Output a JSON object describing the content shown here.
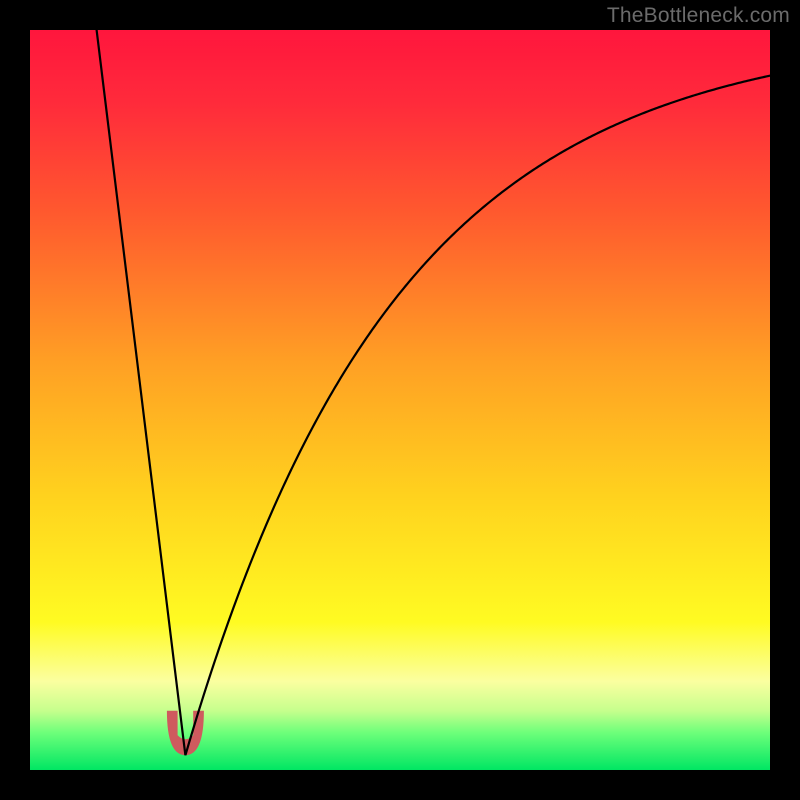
{
  "watermark": "TheBottleneck.com",
  "gradient_stops": [
    {
      "offset": 0.0,
      "color": "#ff163d"
    },
    {
      "offset": 0.1,
      "color": "#ff2b3b"
    },
    {
      "offset": 0.25,
      "color": "#ff5a2e"
    },
    {
      "offset": 0.45,
      "color": "#ffa024"
    },
    {
      "offset": 0.63,
      "color": "#ffd21e"
    },
    {
      "offset": 0.8,
      "color": "#fffb22"
    },
    {
      "offset": 0.88,
      "color": "#fbffa0"
    },
    {
      "offset": 0.92,
      "color": "#c6ff8d"
    },
    {
      "offset": 0.95,
      "color": "#6cff7a"
    },
    {
      "offset": 1.0,
      "color": "#00e663"
    }
  ],
  "chart_data": {
    "type": "line",
    "title": "",
    "xlabel": "",
    "ylabel": "",
    "xlim": [
      0,
      100
    ],
    "ylim": [
      0,
      100
    ],
    "x_min_at": 21,
    "min_value": 2,
    "left": {
      "x0": 9,
      "y0": 100,
      "slope": -8.17
    },
    "right_curve": {
      "asymptote": 100,
      "k": 0.035
    },
    "marker": {
      "x_center": 21,
      "width": 5,
      "height": 6,
      "color": "#cf5a5e"
    },
    "series": [
      {
        "name": "bottleneck-curve",
        "x": [
          9,
          12,
          15,
          18,
          20,
          21,
          22,
          24,
          27,
          30,
          35,
          40,
          45,
          50,
          55,
          60,
          65,
          70,
          75,
          80,
          85,
          90,
          95,
          100
        ],
        "y": [
          100,
          75.5,
          51.0,
          26.5,
          10.2,
          2.0,
          5.3,
          12.1,
          21.0,
          28.6,
          40.0,
          49.1,
          56.5,
          62.5,
          67.4,
          71.3,
          74.5,
          77.1,
          79.2,
          80.8,
          82.2,
          83.3,
          84.2,
          84.9
        ]
      }
    ]
  }
}
